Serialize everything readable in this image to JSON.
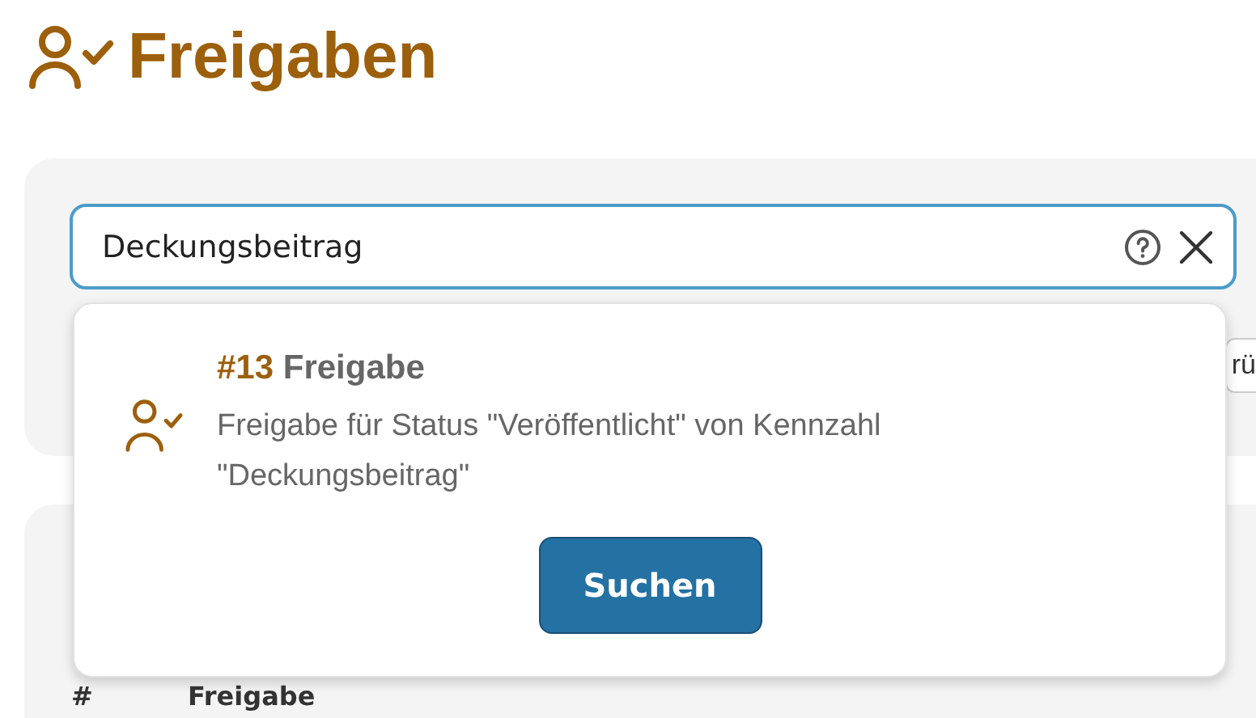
{
  "page": {
    "title": "Freigaben"
  },
  "search": {
    "value": "Deckungsbeitrag"
  },
  "filter_button": {
    "label": "rü"
  },
  "suggestions": [
    {
      "number": "#13",
      "title": "Freigabe",
      "description": "Freigabe für Status \"Veröffentlicht\" von Kennzahl \"Deckungsbeitrag\""
    }
  ],
  "search_button": {
    "label": "Suchen"
  },
  "table": {
    "columns": [
      "#",
      "Freigabe"
    ]
  }
}
